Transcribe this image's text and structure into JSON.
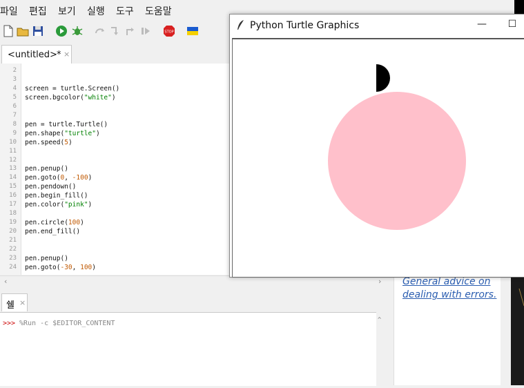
{
  "menubar": {
    "items": [
      "파일",
      "편집",
      "보기",
      "실행",
      "도구",
      "도움말"
    ]
  },
  "toolbar": {
    "buttons": [
      "new-file-icon",
      "open-folder-icon",
      "save-icon",
      "run-icon",
      "debug-icon",
      "step-over-icon",
      "step-into-icon",
      "step-out-icon",
      "resume-icon",
      "stop-icon",
      "ukraine-flag-icon"
    ]
  },
  "editor": {
    "tab": {
      "title": "<untitled>",
      "modified": "*",
      "close": "×"
    },
    "line_numbers": [
      "2",
      "3",
      "4",
      "5",
      "6",
      "7",
      "8",
      "9",
      "10",
      "11",
      "12",
      "13",
      "14",
      "15",
      "16",
      "17",
      "18",
      "19",
      "20",
      "21",
      "22",
      "23",
      "24"
    ],
    "lines": [
      "",
      "",
      "screen = turtle.Screen()",
      "screen.bgcolor(\"white\")",
      "",
      "",
      "pen = turtle.Turtle()",
      "pen.shape(\"turtle\")",
      "pen.speed(5)",
      "",
      "",
      "pen.penup()",
      "pen.goto(0, -100)",
      "pen.pendown()",
      "pen.begin_fill()",
      "pen.color(\"pink\")",
      "",
      "pen.circle(100)",
      "pen.end_fill()",
      "",
      "",
      "pen.penup()",
      "pen.goto(-30, 100)"
    ]
  },
  "shell": {
    "tab_title": "쉘",
    "close": "×",
    "prompt": ">>>",
    "command": "%Run -c $EDITOR_CONTENT"
  },
  "helper": {
    "link_line1": "General advice on",
    "link_line2": "dealing with errors."
  },
  "turtle_window": {
    "title": "Python Turtle Graphics",
    "minimize": "—",
    "maximize": "☐",
    "fill_color": "#ffc0cb",
    "pen_color": "#000000"
  },
  "colors": {
    "string": "#008000",
    "number": "#c05800",
    "link": "#2a5db0",
    "prompt": "#cc0000"
  }
}
